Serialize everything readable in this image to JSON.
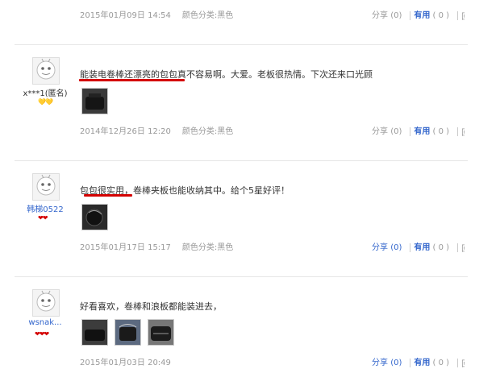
{
  "reviews": [
    {
      "date": "2015年01月09日 14:54",
      "variant": "颜色分类:黑色",
      "share": "分享",
      "share_count": "(0)",
      "useful": "有用",
      "useful_count": "( 0 )",
      "cut_char": "回"
    },
    {
      "user": "x***1(匿名)",
      "badge": "💛💛",
      "text": "能装电卷棒还漂亮的包包真不容易啊。大爱。老板很热情。下次还来口光顾",
      "date": "2014年12月26日 12:20",
      "variant": "颜色分类:黑色",
      "share": "分享",
      "share_count": "(0)",
      "useful": "有用",
      "useful_count": "( 0 )",
      "cut_char": "回"
    },
    {
      "user": "韩梯0522",
      "badge": "❤❤",
      "text": "包包很实用，卷棒夹板也能收纳其中。给个5星好评！",
      "date": "2015年01月17日 15:17",
      "variant": "颜色分类:黑色",
      "share": "分享",
      "share_count": "(0)",
      "useful": "有用",
      "useful_count": "( 0 )",
      "cut_char": "回"
    },
    {
      "user": "wsnak...",
      "badge": "❤❤❤",
      "text": "好看喜欢，卷棒和浪板都能装进去，",
      "date": "2015年01月03日 20:49",
      "share": "分享",
      "share_count": "(0)",
      "useful": "有用",
      "useful_count": "( 0 )",
      "cut_char": "回"
    }
  ],
  "colors": {
    "accent_blue": "#3366cc",
    "underline_red": "#d40000"
  }
}
